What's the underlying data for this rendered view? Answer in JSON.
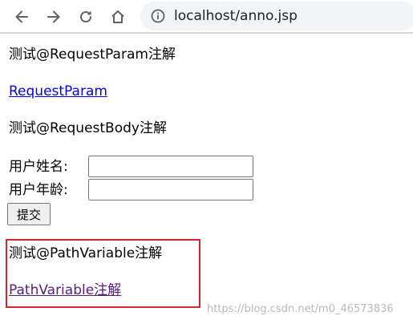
{
  "browser": {
    "url": "localhost/anno.jsp",
    "nav_icons": [
      "back-arrow-icon",
      "forward-arrow-icon",
      "reload-icon",
      "home-icon",
      "info-icon"
    ]
  },
  "page": {
    "section1_heading": "测试@RequestParam注解",
    "section1_link": "RequestParam",
    "section2_heading": "测试@RequestBody注解",
    "username_label": "用户姓名:",
    "username_value": "",
    "age_label": "用户年龄:",
    "age_value": "",
    "submit_label": "提交",
    "section3_heading": "测试@PathVariable注解",
    "section3_link": "PathVariable注解"
  },
  "annotation": {
    "highlight_color": "#d0262d"
  },
  "watermark": "https://blog.csdn.net/m0_46573836",
  "colors": {
    "link": "#0000ee",
    "visited_link": "#551a8b",
    "omnibox_bg": "#f1f3f4"
  }
}
